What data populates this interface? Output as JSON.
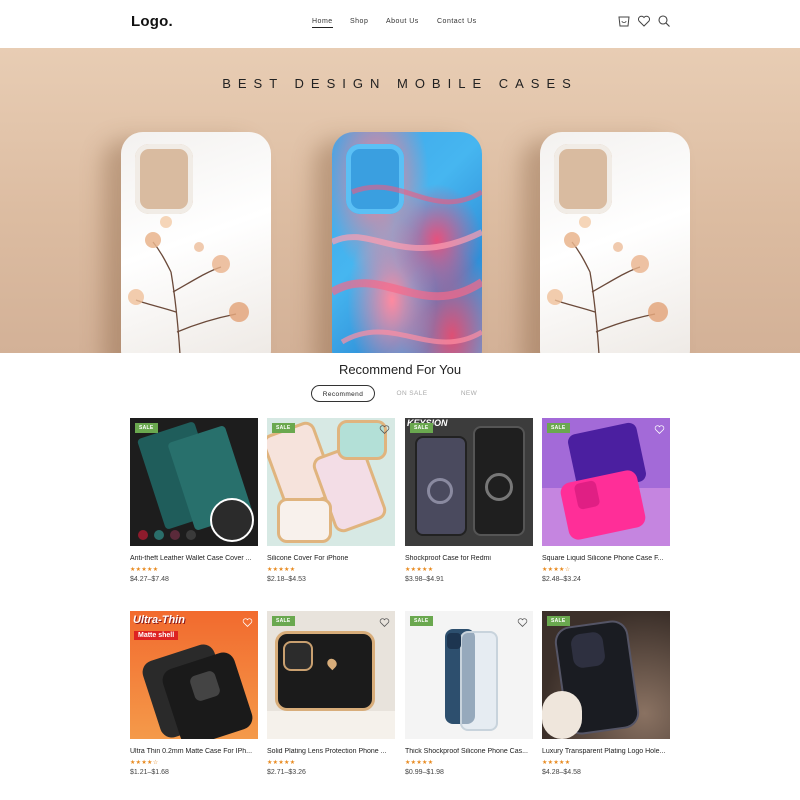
{
  "header": {
    "logo": "Logo.",
    "nav": [
      {
        "label": "Home",
        "active": true
      },
      {
        "label": "Shop",
        "active": false
      },
      {
        "label": "About Us",
        "active": false
      },
      {
        "label": "Contact Us",
        "active": false
      }
    ],
    "icons": [
      "cart-icon",
      "heart-icon",
      "search-icon"
    ]
  },
  "hero": {
    "title": "BEST DESIGN MOBILE CASES"
  },
  "recommend": {
    "title": "Recommend For You",
    "tabs": [
      {
        "label": "Recommend",
        "active": true
      },
      {
        "label": "ON SALE",
        "active": false
      },
      {
        "label": "NEW",
        "active": false
      }
    ]
  },
  "products": [
    {
      "name": "Anti-theft Leather Wallet Case Cover ...",
      "price": "$4.27–$7.48",
      "stars": "★★★★★",
      "sale": "SALE"
    },
    {
      "name": "Silicone Cover For iPhone",
      "price": "$2.18–$4.53",
      "stars": "★★★★★",
      "sale": "SALE"
    },
    {
      "name": "Shockproof Case for Redmi",
      "price": "$3.98–$4.91",
      "stars": "★★★★★",
      "sale": "SALE",
      "brand_text": "KEYSION"
    },
    {
      "name": "Square Liquid Silicone Phone Case F...",
      "price": "$2.48–$3.24",
      "stars": "★★★★☆",
      "sale": "SALE"
    },
    {
      "name": "Ultra Thin 0.2mm Matte Case For IPh...",
      "price": "$1.21–$1.68",
      "stars": "★★★★☆",
      "sale": "",
      "banner_top": "Ultra-Thin",
      "banner_bottom": "Matte shell"
    },
    {
      "name": "Solid Plating Lens Protection Phone ...",
      "price": "$2.71–$3.26",
      "stars": "★★★★★",
      "sale": "SALE"
    },
    {
      "name": "Thick Shockproof Silicone Phone Cas...",
      "price": "$0.99–$1.98",
      "stars": "★★★★★",
      "sale": "SALE"
    },
    {
      "name": "Luxury Transparent Plating Logo Hole...",
      "price": "$4.28–$4.58",
      "stars": "★★★★★",
      "sale": "SALE"
    }
  ],
  "colors": {
    "sale_badge": "#6aa84f",
    "stars": "#e88a1f",
    "hero_bg": "#dcbca1"
  }
}
